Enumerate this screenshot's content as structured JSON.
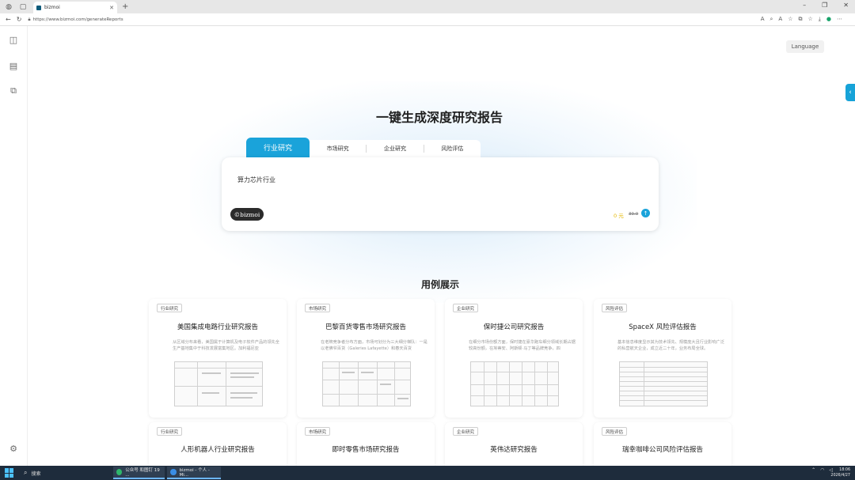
{
  "browser": {
    "tab_title": "bizmoi",
    "url": "https://www.bizmoi.com/generateReports",
    "back_icon": "arrow-left-icon",
    "refresh_icon": "refresh-icon"
  },
  "header": {
    "language_label": "Language"
  },
  "hero": {
    "title": "一键生成深度研究报告"
  },
  "mode_tabs": [
    {
      "label": "行业研究",
      "active": true
    },
    {
      "label": "市场研究",
      "active": false
    },
    {
      "label": "企业研究",
      "active": false
    },
    {
      "label": "风险评估",
      "active": false
    }
  ],
  "input": {
    "value": "算力芯片行业",
    "brand": "©bizmoi",
    "credit": "0 元",
    "price_old": "39.9",
    "accent_color": "#1aa3da"
  },
  "examples": {
    "title": "用例展示",
    "cards": [
      {
        "tag": "行业研究",
        "title": "美国集成电路行业研究报告",
        "desc": "从区域分布来看，美国属于计算机及电子软件产品的领先全生产基地集中于科技发展富集地区。加利福尼亚"
      },
      {
        "tag": "市场研究",
        "title": "巴黎百货零售市场研究报告",
        "desc": "在老牌竞争者分布方面，市场可划分为三大细分梯队：一是以老佛爷百货（Galeries Lafayette）和春天百货"
      },
      {
        "tag": "企业研究",
        "title": "保时捷公司研究报告",
        "desc": "在细分市场份额方面，保时捷在豪华跑车细分领域长期占据较高份额，在埃蒂安、阿斯顿·马丁等品牌竞争，四"
      },
      {
        "tag": "风险评估",
        "title": "SpaceX 风险评估报告",
        "desc": "基本信息维度显示其为技术领先、规模庞大且行业影响广泛的私营航天企业，成立近二十年，业务布局全球。"
      }
    ],
    "cards_row2": [
      {
        "tag": "行业研究",
        "title": "人形机器人行业研究报告"
      },
      {
        "tag": "市场研究",
        "title": "即时零售市场研究报告"
      },
      {
        "tag": "企业研究",
        "title": "英伟达研究报告"
      },
      {
        "tag": "风险评估",
        "title": "瑞幸咖啡公司风险评估报告"
      }
    ]
  },
  "taskbar": {
    "search_label": "搜索",
    "apps": [
      {
        "label": "公众号 和图钉 19 ..."
      },
      {
        "label": "bizmoi - 个人 - Mi..."
      }
    ],
    "time": "18:06",
    "date": "2026/4/27"
  }
}
